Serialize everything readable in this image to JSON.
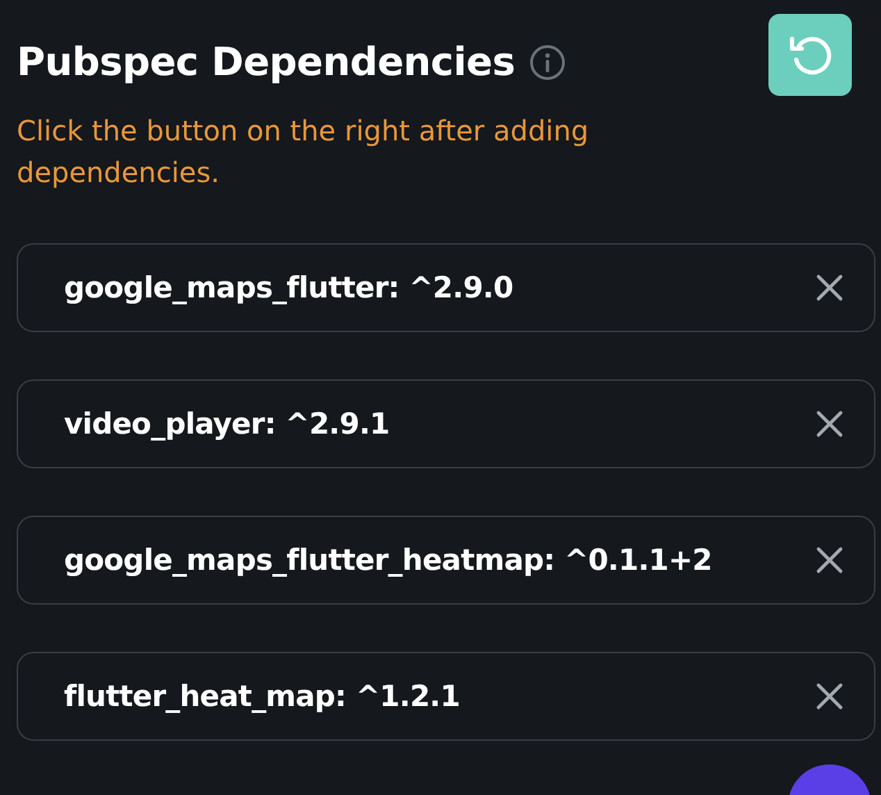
{
  "header": {
    "title": "Pubspec Dependencies",
    "hint": "Click the button on the right after adding dependencies."
  },
  "dependencies": [
    {
      "text": "google_maps_flutter: ^2.9.0"
    },
    {
      "text": "video_player: ^2.9.1"
    },
    {
      "text": "google_maps_flutter_heatmap: ^0.1.1+2"
    },
    {
      "text": "flutter_heat_map: ^1.2.1"
    }
  ]
}
